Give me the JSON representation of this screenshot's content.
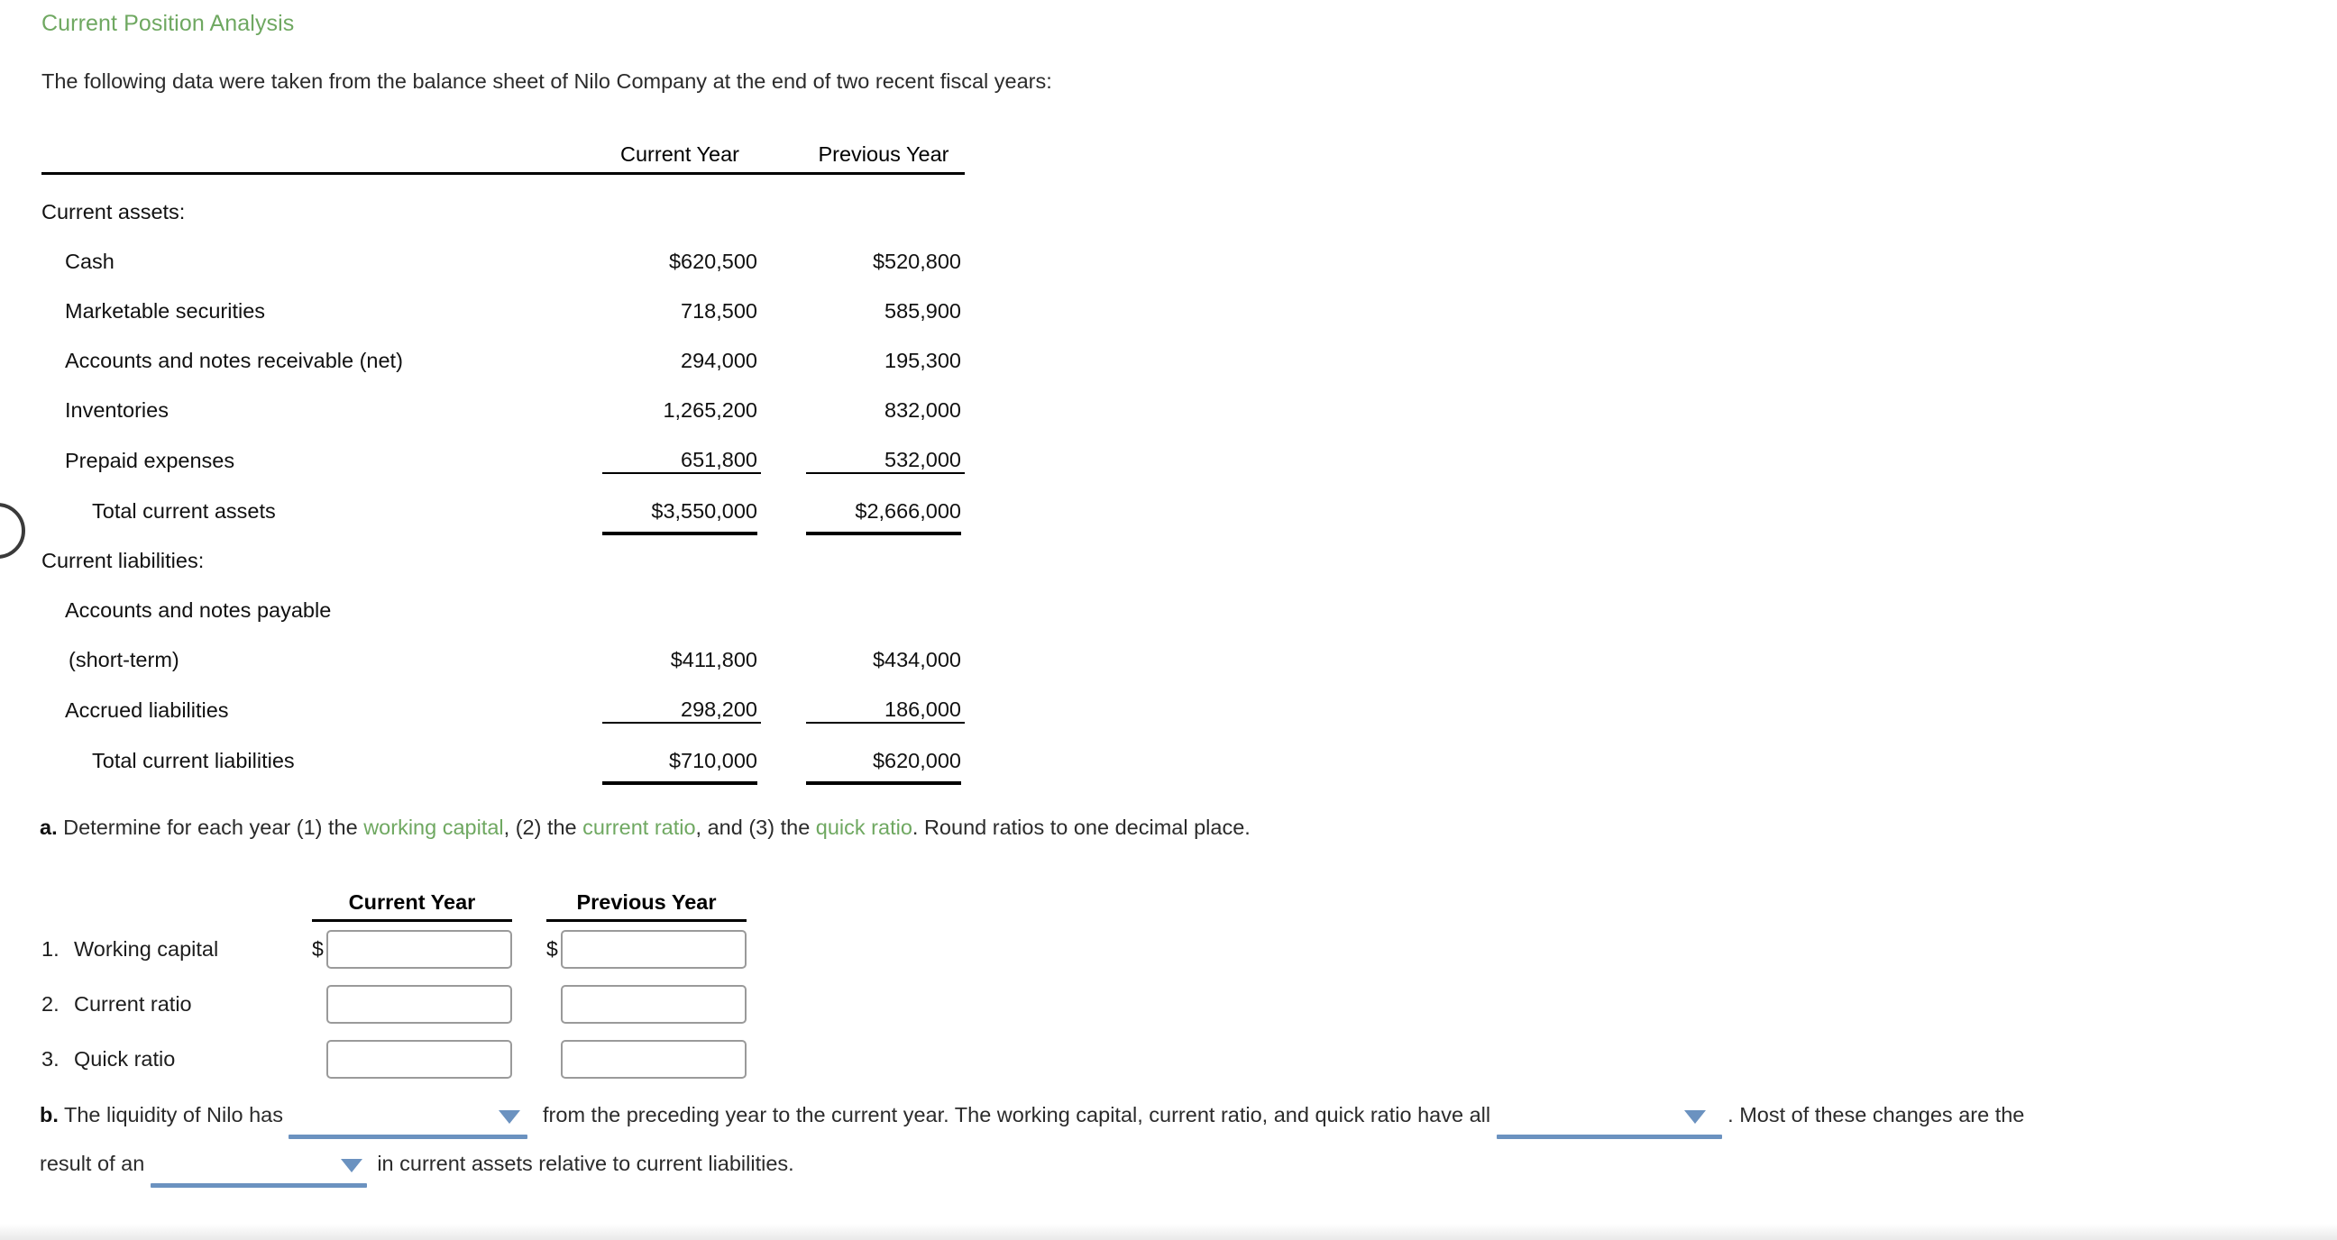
{
  "heading": "Current Position Analysis",
  "intro": "The following data were taken from the balance sheet of Nilo Company at the end of two recent fiscal years:",
  "balance_sheet": {
    "col_headers": [
      "Current Year",
      "Previous Year"
    ],
    "sections": [
      {
        "title": "Current assets:",
        "rows": [
          {
            "label": "Cash",
            "current": "$620,500",
            "previous": "$520,800"
          },
          {
            "label": "Marketable securities",
            "current": "718,500",
            "previous": "585,900"
          },
          {
            "label": "Accounts and notes receivable (net)",
            "current": "294,000",
            "previous": "195,300"
          },
          {
            "label": "Inventories",
            "current": "1,265,200",
            "previous": "832,000"
          },
          {
            "label": "Prepaid expenses",
            "current": "651,800",
            "previous": "532,000"
          }
        ],
        "total": {
          "label": "Total current assets",
          "current": "$3,550,000",
          "previous": "$2,666,000"
        }
      },
      {
        "title": "Current liabilities:",
        "rows": [
          {
            "label": "Accounts and notes payable",
            "current": "",
            "previous": ""
          },
          {
            "label": "(short-term)",
            "current": "$411,800",
            "previous": "$434,000"
          },
          {
            "label": "Accrued liabilities",
            "current": "298,200",
            "previous": "186,000"
          }
        ],
        "total": {
          "label": "Total current liabilities",
          "current": "$710,000",
          "previous": "$620,000"
        }
      }
    ]
  },
  "part_a": {
    "marker": "a.",
    "text_1": "Determine for each year (1) the ",
    "term_1": "working capital",
    "text_2": ", (2) the ",
    "term_2": "current ratio",
    "text_3": ", and (3) the ",
    "term_3": "quick ratio",
    "text_4": ". Round ratios to one decimal place.",
    "col_headers": [
      "Current Year",
      "Previous Year"
    ],
    "rows": [
      {
        "num": "1.",
        "label": "Working capital",
        "prefix": "$",
        "current_value": "",
        "previous_value": "",
        "placeholder": ""
      },
      {
        "num": "2.",
        "label": "Current ratio",
        "prefix": "",
        "current_value": "",
        "previous_value": "",
        "placeholder": ""
      },
      {
        "num": "3.",
        "label": "Quick ratio",
        "prefix": "",
        "current_value": "",
        "previous_value": "",
        "placeholder": ""
      }
    ]
  },
  "part_b": {
    "marker": "b.",
    "text_1": "The liquidity of Nilo has",
    "dropdown_1_value": "",
    "text_2": "from the preceding year to the current year. The working capital, current ratio, and quick ratio have all",
    "dropdown_2_value": "",
    "text_3": ". Most of these changes are the",
    "text_4": "result of an",
    "dropdown_3_value": "",
    "text_5": "in current assets relative to current liabilities."
  },
  "colors": {
    "heading_green": "#6fa861",
    "term_green": "#6fa861",
    "dropdown_blue": "#6b92c0",
    "input_border": "#9a9a9a",
    "text": "#2b2b2b"
  }
}
